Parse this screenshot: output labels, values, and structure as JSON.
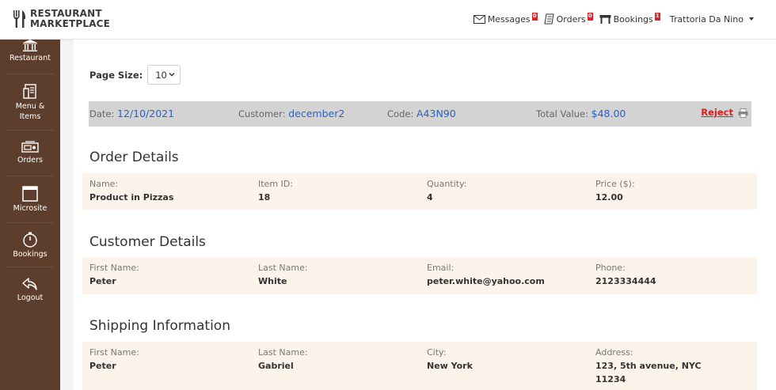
{
  "brand": {
    "line1": "RESTAURANT",
    "line2": "MARKETPLACE"
  },
  "topnav": {
    "messages_label": "Messages",
    "messages_count": "0",
    "orders_label": "Orders",
    "orders_count": "0",
    "bookings_label": "Bookings",
    "bookings_count": "1",
    "user_name": "Trattoria Da Nino"
  },
  "sidebar": {
    "items": [
      {
        "label": "Restaurant",
        "icon": "building-icon"
      },
      {
        "label": "Menu &\nItems",
        "icon": "menu-icon"
      },
      {
        "label": "Orders",
        "icon": "orders-icon"
      },
      {
        "label": "Microsite",
        "icon": "window-icon"
      },
      {
        "label": "Bookings",
        "icon": "stopwatch-icon"
      },
      {
        "label": "Logout",
        "icon": "logout-icon"
      }
    ]
  },
  "page_size": {
    "label": "Page Size:",
    "value": "10"
  },
  "order_summary": {
    "date_label": "Date:",
    "date": "12/10/2021",
    "customer_label": "Customer:",
    "customer": "december2",
    "code_label": "Code:",
    "code": "A43N90",
    "total_label": "Total Value:",
    "total": "$48.00",
    "reject_label": "Reject"
  },
  "order_details": {
    "title": "Order Details",
    "fields": [
      {
        "label": "Name:",
        "value": "Product in Pizzas"
      },
      {
        "label": "Item ID:",
        "value": "18"
      },
      {
        "label": "Quantity:",
        "value": "4"
      },
      {
        "label": "Price ($):",
        "value": "12.00"
      }
    ]
  },
  "customer_details": {
    "title": "Customer Details",
    "fields": [
      {
        "label": "First Name:",
        "value": "Peter"
      },
      {
        "label": "Last Name:",
        "value": "White"
      },
      {
        "label": "Email:",
        "value": "peter.white@yahoo.com"
      },
      {
        "label": "Phone:",
        "value": "2123334444"
      }
    ]
  },
  "shipping": {
    "title": "Shipping Information",
    "fields": [
      {
        "label": "First Name:",
        "value": "Peter"
      },
      {
        "label": "Last Name:",
        "value": "Gabriel"
      },
      {
        "label": "City:",
        "value": "New York"
      },
      {
        "label": "Address:",
        "value": "123, 5th avenue, NYC 11234"
      }
    ]
  },
  "colors": {
    "sidebar": "#5d3e2c",
    "link": "#2d5fc4",
    "reject": "#d42020",
    "row_bg": "#fcf4ea",
    "badge": "#d9262b"
  }
}
